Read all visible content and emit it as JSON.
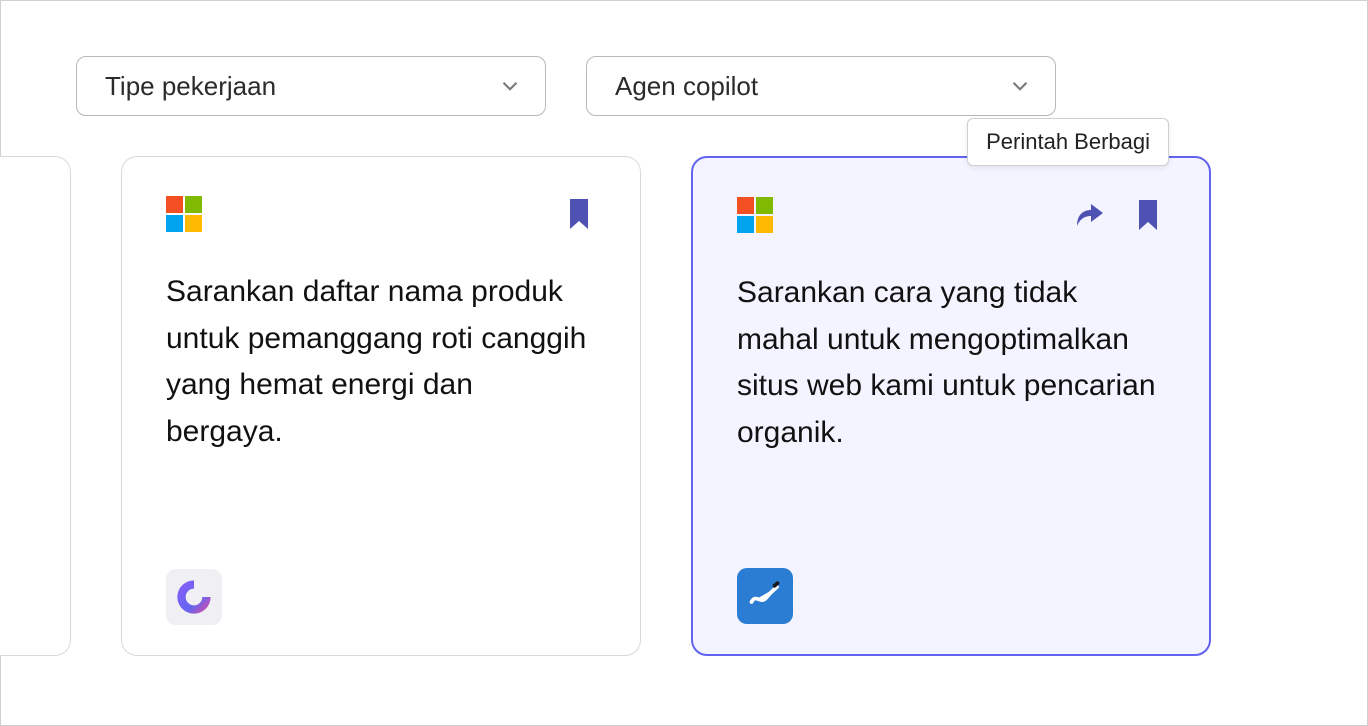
{
  "filters": {
    "job_type": {
      "label": "Tipe pekerjaan"
    },
    "agent": {
      "label": "Agen copilot"
    }
  },
  "tooltip": {
    "share_command": "Perintah Berbagi"
  },
  "cards": [
    {
      "text": "Sarankan daftar nama produk untuk pemanggang roti canggih yang hemat energi dan bergaya.",
      "app": "loop"
    },
    {
      "text": "Sarankan cara yang tidak mahal untuk mengoptimalkan situs web kami untuk pencarian organik.",
      "app": "whiteboard"
    }
  ]
}
